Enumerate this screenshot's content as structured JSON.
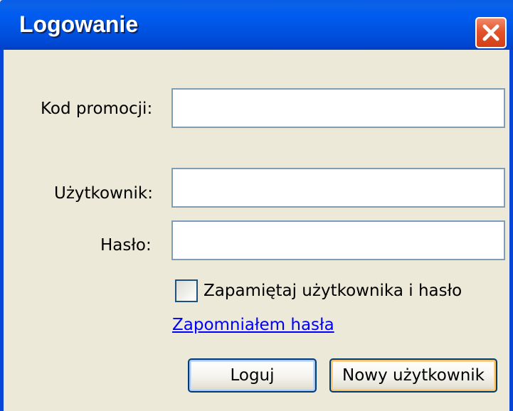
{
  "window": {
    "title": "Logowanie",
    "close_icon": "close-icon"
  },
  "form": {
    "promo_label": "Kod promocji:",
    "promo_value": "",
    "user_label": "Użytkownik:",
    "user_value": "",
    "password_label": "Hasło:",
    "password_value": "",
    "remember_label": "Zapamiętaj użytkownika i hasło",
    "remember_checked": false,
    "forgot_link": "Zapomniałem hasła"
  },
  "buttons": {
    "login_label": "Loguj",
    "new_user_label": "Nowy użytkownik"
  },
  "colors": {
    "title_bar": "#0054e3",
    "close_button": "#e2542c",
    "dialog_background": "#ece9d8",
    "link": "#0000ff",
    "field_border": "#7f9db9"
  }
}
